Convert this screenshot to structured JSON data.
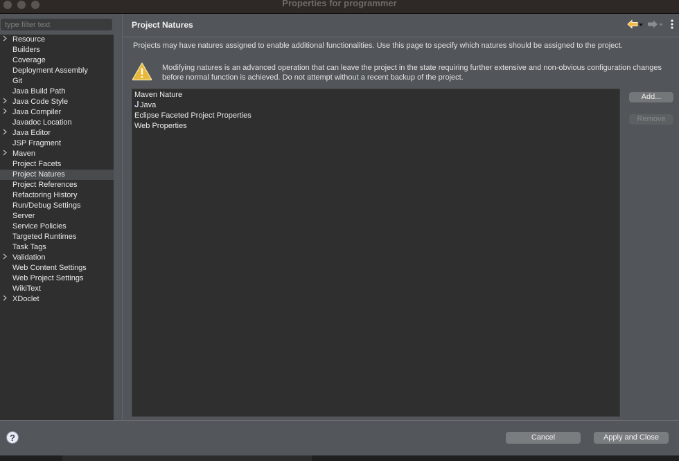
{
  "window": {
    "title": "Properties for programmer"
  },
  "sidebar": {
    "filter_placeholder": "type filter text",
    "filter_value": "",
    "selected": "Project Natures",
    "items": [
      {
        "label": "Resource",
        "expandable": true
      },
      {
        "label": "Builders",
        "expandable": false
      },
      {
        "label": "Coverage",
        "expandable": false
      },
      {
        "label": "Deployment Assembly",
        "expandable": false
      },
      {
        "label": "Git",
        "expandable": false
      },
      {
        "label": "Java Build Path",
        "expandable": false
      },
      {
        "label": "Java Code Style",
        "expandable": true
      },
      {
        "label": "Java Compiler",
        "expandable": true
      },
      {
        "label": "Javadoc Location",
        "expandable": false
      },
      {
        "label": "Java Editor",
        "expandable": true
      },
      {
        "label": "JSP Fragment",
        "expandable": false
      },
      {
        "label": "Maven",
        "expandable": true
      },
      {
        "label": "Project Facets",
        "expandable": false
      },
      {
        "label": "Project Natures",
        "expandable": false
      },
      {
        "label": "Project References",
        "expandable": false
      },
      {
        "label": "Refactoring History",
        "expandable": false
      },
      {
        "label": "Run/Debug Settings",
        "expandable": false
      },
      {
        "label": "Server",
        "expandable": false
      },
      {
        "label": "Service Policies",
        "expandable": false
      },
      {
        "label": "Targeted Runtimes",
        "expandable": false
      },
      {
        "label": "Task Tags",
        "expandable": false
      },
      {
        "label": "Validation",
        "expandable": true
      },
      {
        "label": "Web Content Settings",
        "expandable": false
      },
      {
        "label": "Web Project Settings",
        "expandable": false
      },
      {
        "label": "WikiText",
        "expandable": false
      },
      {
        "label": "XDoclet",
        "expandable": true
      }
    ]
  },
  "page": {
    "title": "Project Natures",
    "description": "Projects may have natures assigned to enable additional functionalities. Use this page to specify which natures should be assigned to the project.",
    "warning": "Modifying natures is an advanced operation that can leave the project in the state requiring further extensive and non-obvious configuration changes before normal function is achieved. Do not attempt without a recent backup of the project.",
    "natures": [
      {
        "label": "Maven Nature",
        "icon": ""
      },
      {
        "label": "Java",
        "icon": "java-nature-icon"
      },
      {
        "label": "Eclipse Faceted Project Properties",
        "icon": ""
      },
      {
        "label": "Web Properties",
        "icon": ""
      }
    ],
    "add_label": "Add...",
    "remove_label": "Remove",
    "colors": {
      "back_arrow": "#f5b942",
      "forward_arrow": "#8c8f91",
      "warning": "#e8b83a"
    }
  },
  "footer": {
    "cancel_label": "Cancel",
    "apply_close_label": "Apply and Close"
  }
}
